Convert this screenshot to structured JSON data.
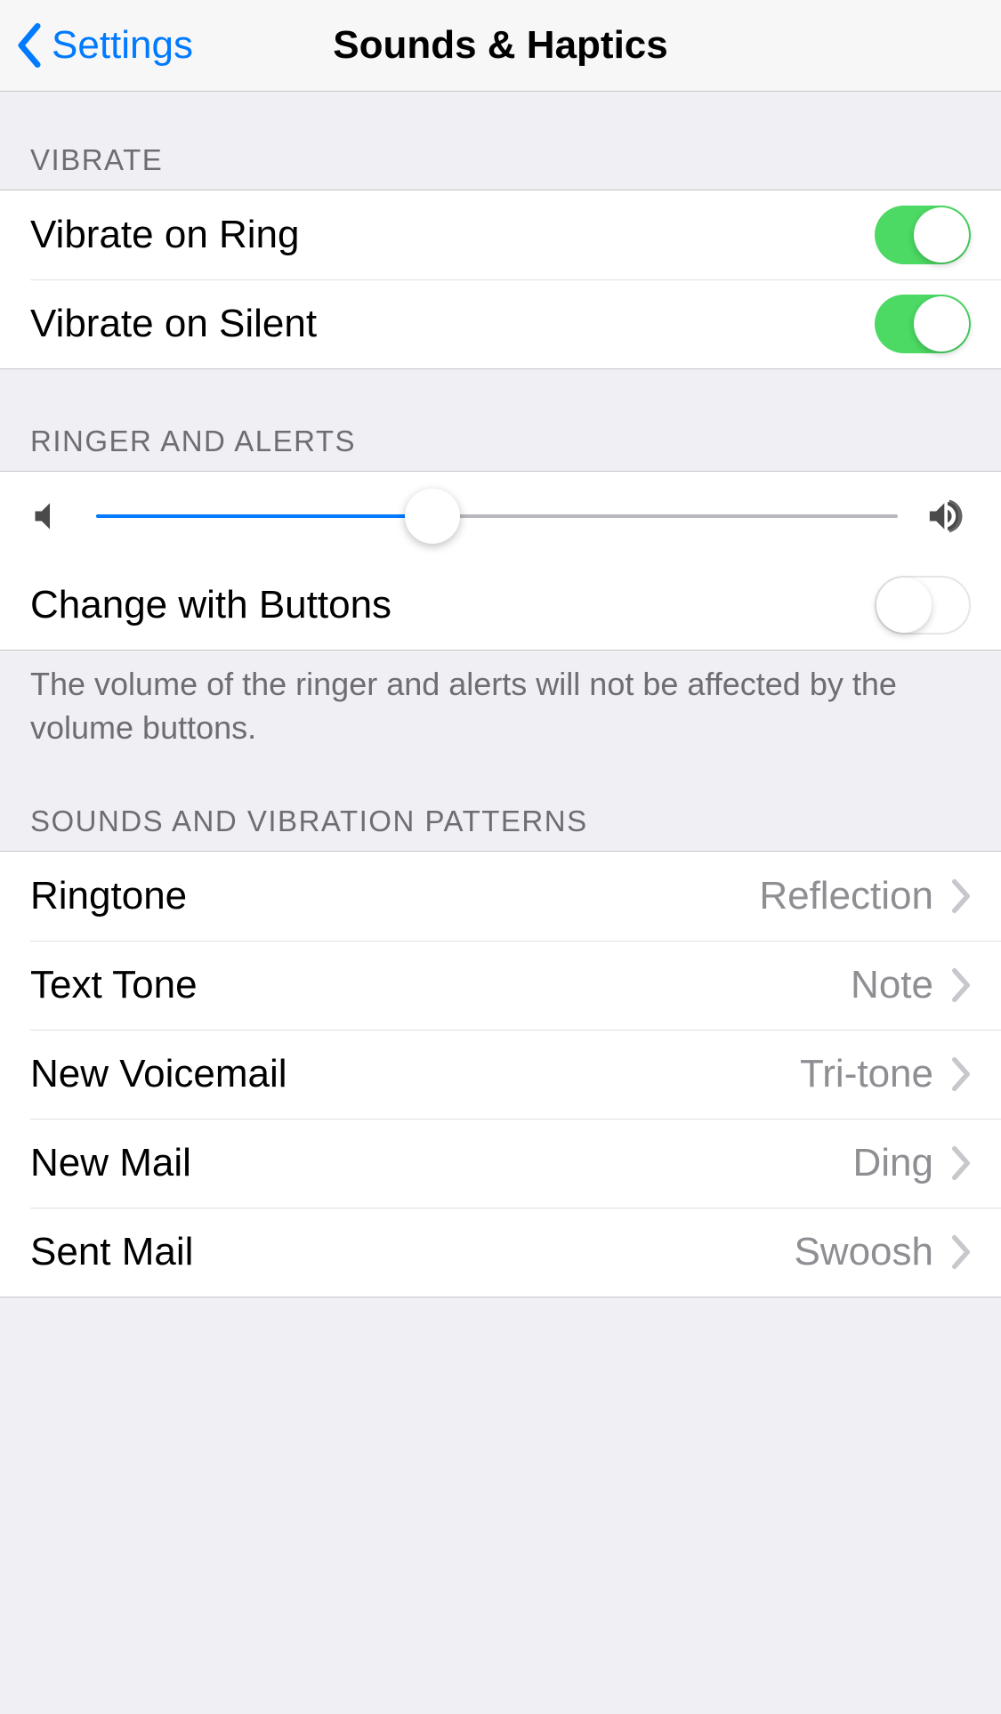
{
  "nav": {
    "back_label": "Settings",
    "title": "Sounds & Haptics"
  },
  "sections": {
    "vibrate": {
      "header": "Vibrate",
      "items": [
        {
          "label": "Vibrate on Ring",
          "on": true
        },
        {
          "label": "Vibrate on Silent",
          "on": true
        }
      ]
    },
    "ringer": {
      "header": "Ringer and Alerts",
      "slider_value": 42,
      "change_with_buttons": {
        "label": "Change with Buttons",
        "on": false
      },
      "footer": "The volume of the ringer and alerts will not be affected by the volume buttons."
    },
    "sounds": {
      "header": "Sounds and Vibration Patterns",
      "items": [
        {
          "label": "Ringtone",
          "value": "Reflection"
        },
        {
          "label": "Text Tone",
          "value": "Note"
        },
        {
          "label": "New Voicemail",
          "value": "Tri-tone"
        },
        {
          "label": "New Mail",
          "value": "Ding"
        },
        {
          "label": "Sent Mail",
          "value": "Swoosh"
        }
      ]
    }
  },
  "colors": {
    "accent": "#007aff",
    "toggle_on": "#4cd964"
  }
}
